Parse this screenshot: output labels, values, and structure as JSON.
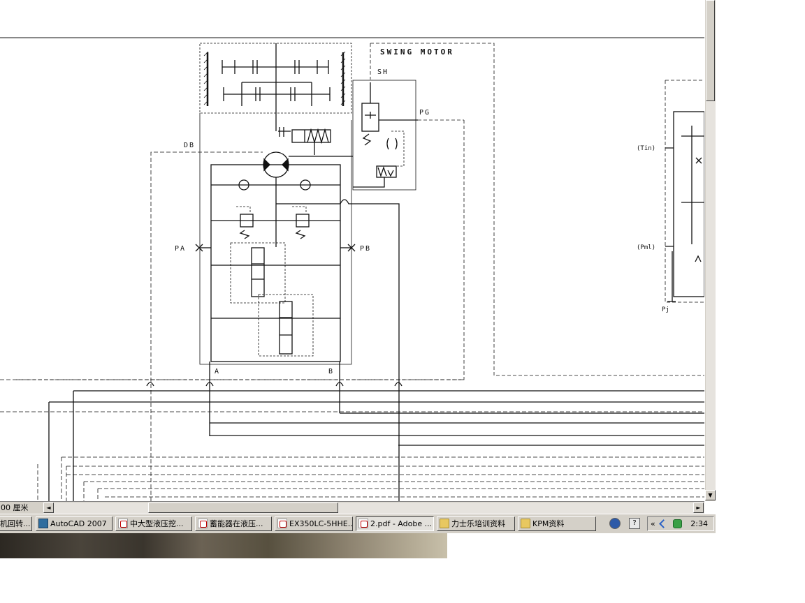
{
  "diagram": {
    "labels": {
      "swing_motor": "SWING MOTOR",
      "sh": "SH",
      "pg": "PG",
      "db": "DB",
      "pa": "PA",
      "pb": "PB",
      "a": "A",
      "b": "B",
      "tin": "(Tin)",
      "pml": "(Pml)",
      "pj": "Pj"
    }
  },
  "statusbar": {
    "page_size": "00 厘米"
  },
  "taskbar": {
    "tasks": [
      {
        "label": "机回转..."
      },
      {
        "label": "AutoCAD 2007"
      },
      {
        "label": "中大型液压挖..."
      },
      {
        "label": "蓄能器在液压..."
      },
      {
        "label": "EX350LC-5HHE..."
      },
      {
        "label": "2.pdf - Adobe ..."
      },
      {
        "label": "力士乐培训资料"
      },
      {
        "label": "KPM资料"
      }
    ],
    "tray": {
      "collapse": "«",
      "clock": "2:34"
    },
    "quick_help": "?"
  }
}
